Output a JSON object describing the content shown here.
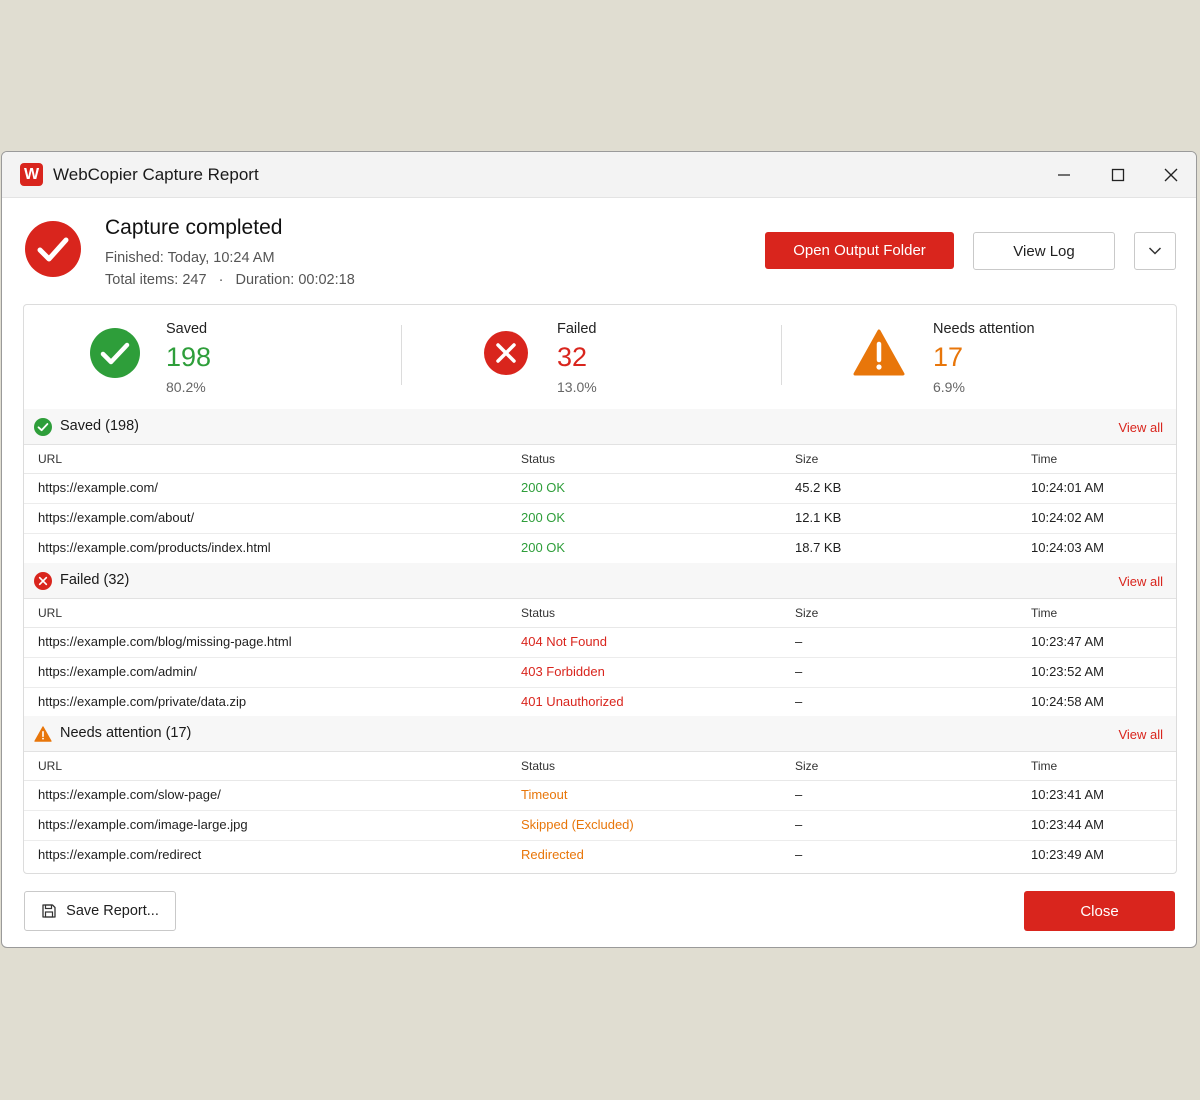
{
  "window": {
    "app_logo_letter": "W",
    "title": "WebCopier Capture Report"
  },
  "header": {
    "title": "Capture completed",
    "finished": "Finished: Today, 10:24 AM",
    "total_items": "Total items: 247",
    "separator": "·",
    "duration": "Duration: 00:02:18",
    "open_folder_label": "Open Output Folder",
    "view_log_label": "View Log"
  },
  "summary": [
    {
      "label": "Saved",
      "value": "198",
      "percent": "80.2%",
      "color": "#2e9e3a"
    },
    {
      "label": "Failed",
      "value": "32",
      "percent": "13.0%",
      "color": "#d9251d"
    },
    {
      "label": "Needs attention",
      "value": "17",
      "percent": "6.9%",
      "color": "#e8760a"
    }
  ],
  "columns": {
    "url": "URL",
    "status": "Status",
    "size": "Size",
    "time": "Time"
  },
  "sections": [
    {
      "title": "Saved (198)",
      "view_all": "View all",
      "icon": "check-circle-icon",
      "status_color": "#2e9e3a",
      "rows": [
        {
          "url": "https://example.com/",
          "status": "200 OK",
          "size": "45.2 KB",
          "time": "10:24:01 AM"
        },
        {
          "url": "https://example.com/about/",
          "status": "200 OK",
          "size": "12.1 KB",
          "time": "10:24:02 AM"
        },
        {
          "url": "https://example.com/products/index.html",
          "status": "200 OK",
          "size": "18.7 KB",
          "time": "10:24:03 AM"
        }
      ]
    },
    {
      "title": "Failed (32)",
      "view_all": "View all",
      "icon": "error-circle-icon",
      "status_color": "#d9251d",
      "rows": [
        {
          "url": "https://example.com/blog/missing-page.html",
          "status": "404 Not Found",
          "size": "–",
          "time": "10:23:47 AM"
        },
        {
          "url": "https://example.com/admin/",
          "status": "403 Forbidden",
          "size": "–",
          "time": "10:23:52 AM"
        },
        {
          "url": "https://example.com/private/data.zip",
          "status": "401 Unauthorized",
          "size": "–",
          "time": "10:24:58 AM"
        }
      ]
    },
    {
      "title": "Needs attention (17)",
      "view_all": "View all",
      "icon": "warning-triangle-icon",
      "status_color": "#e8760a",
      "rows": [
        {
          "url": "https://example.com/slow-page/",
          "status": "Timeout",
          "size": "–",
          "time": "10:23:41 AM"
        },
        {
          "url": "https://example.com/image-large.jpg",
          "status": "Skipped (Excluded)",
          "size": "–",
          "time": "10:23:44 AM"
        },
        {
          "url": "https://example.com/redirect",
          "status": "Redirected",
          "size": "–",
          "time": "10:23:49 AM"
        }
      ]
    }
  ],
  "footer": {
    "save_report_label": "Save Report...",
    "close_label": "Close"
  },
  "colors": {
    "accent": "#d9251d",
    "success": "#2e9e3a",
    "warning": "#e8760a"
  }
}
